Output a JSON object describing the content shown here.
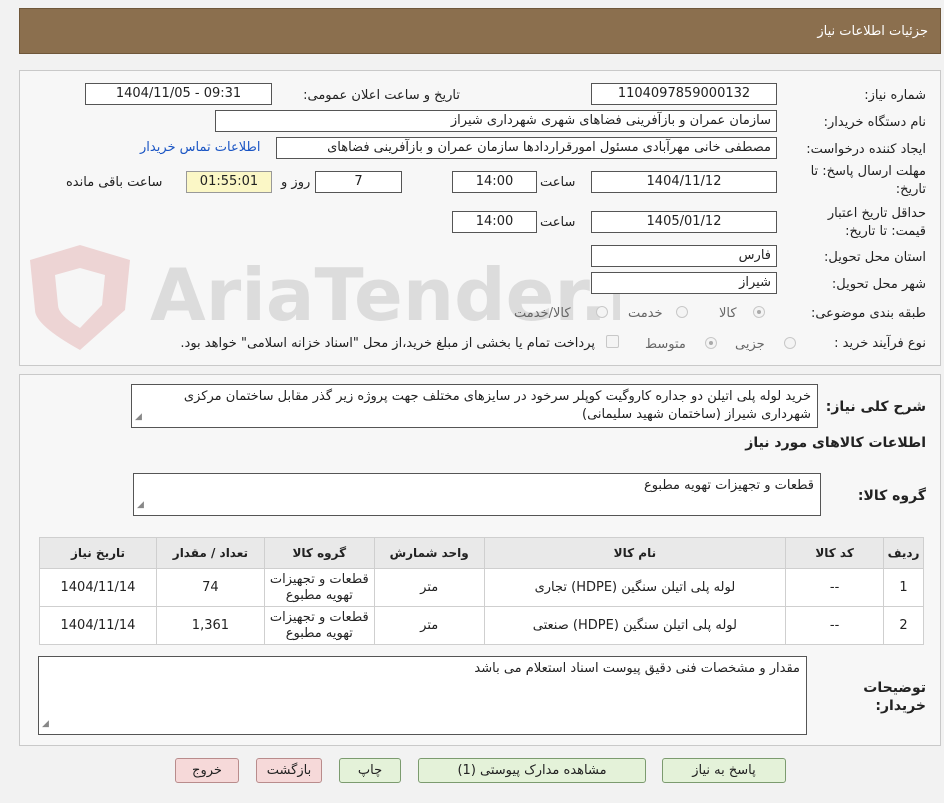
{
  "header": {
    "title": "جزئیات اطلاعات نیاز"
  },
  "watermark": {
    "text": "AriaTender.neT"
  },
  "form": {
    "need_number_label": "شماره نیاز:",
    "need_number": "1104097859000132",
    "announce_label": "تاریخ و ساعت اعلان عمومی:",
    "announce_value": "1404/11/05 - 09:31",
    "buyer_org_label": "نام دستگاه خریدار:",
    "buyer_org": "سازمان عمران و بازآفرینی فضاهای شهری شهرداری شیراز",
    "requester_label": "ایجاد کننده درخواست:",
    "requester": "مصطفی خانی مهرآبادی مسئول امورقراردادها سازمان عمران و بازآفرینی فضاهای",
    "contact_link": "اطلاعات تماس خریدار",
    "deadline_label_1": "مهلت ارسال پاسخ: تا",
    "deadline_label_2": "تاریخ:",
    "deadline_date": "1404/11/12",
    "time_label": "ساعت",
    "deadline_time": "14:00",
    "days_value": "7",
    "days_label": "روز و",
    "remaining_time": "01:55:01",
    "remaining_label": "ساعت باقی مانده",
    "validity_label_1": "حداقل تاریخ اعتبار",
    "validity_label_2": "قیمت: تا تاریخ:",
    "validity_date": "1405/01/12",
    "validity_time": "14:00",
    "province_label": "استان محل تحویل:",
    "province": "فارس",
    "city_label": "شهر محل تحویل:",
    "city": "شیراز",
    "category_label": "طبقه بندی موضوعی:",
    "category_options": [
      "کالا",
      "خدمت",
      "کالا/خدمت"
    ],
    "category_selected": "کالا",
    "process_label": "نوع فرآیند خرید :",
    "process_options": [
      "جزیی",
      "متوسط"
    ],
    "process_selected": "متوسط",
    "payment_note": "پرداخت تمام یا بخشی از مبلغ خرید،از محل \"اسناد خزانه اسلامی\" خواهد بود."
  },
  "description": {
    "label": "شرح کلی نیاز:",
    "text": "خرید لوله پلی اتیلن دو جداره کاروگیت کوپلر سرخود در سایزهای مختلف جهت پروژه زیر گذر مقابل ساختمان مرکزی شهرداری شیراز (ساختمان شهید سلیمانی)"
  },
  "goods": {
    "section_title": "اطلاعات کالاهای مورد نیاز",
    "group_label": "گروه کالا:",
    "group_value": "قطعات و تجهیزات تهویه مطبوع",
    "columns": [
      "ردیف",
      "کد کالا",
      "نام کالا",
      "واحد شمارش",
      "گروه کالا",
      "تعداد / مقدار",
      "تاریخ نیاز"
    ],
    "rows": [
      {
        "row": "1",
        "code": "--",
        "name": "لوله پلی اتیلن سنگین (HDPE) تجاری",
        "unit": "متر",
        "group": "قطعات و تجهیزات تهویه مطبوع",
        "qty": "74",
        "date": "1404/11/14"
      },
      {
        "row": "2",
        "code": "--",
        "name": "لوله پلی اتیلن سنگین (HDPE) صنعتی",
        "unit": "متر",
        "group": "قطعات و تجهیزات تهویه مطبوع",
        "qty": "1,361",
        "date": "1404/11/14"
      }
    ]
  },
  "notes": {
    "label_1": "توضیحات",
    "label_2": "خریدار:",
    "text": "مقدار و مشخصات فنی دقیق پیوست اسناد استعلام می باشد"
  },
  "buttons": {
    "reply": "پاسخ به نیاز",
    "attachments": "مشاهده مدارک پیوستی (1)",
    "print": "چاپ",
    "back": "بازگشت",
    "exit": "خروج"
  }
}
